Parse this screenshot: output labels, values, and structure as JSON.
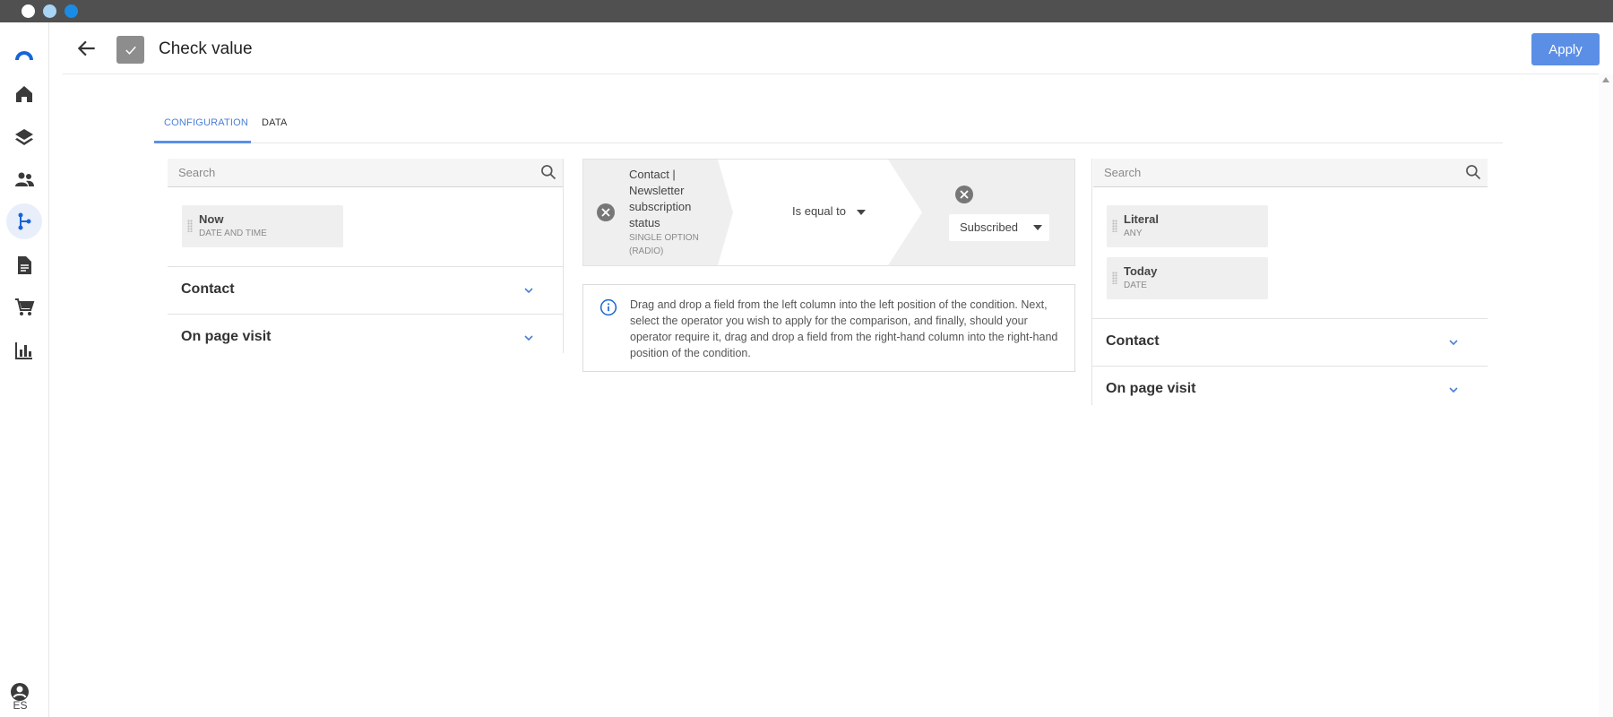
{
  "window": {
    "dots": [
      "#ffffff",
      "#a8d4f5",
      "#1a8ce8"
    ]
  },
  "sidebar": {
    "items": [
      {
        "icon": "logo-icon"
      },
      {
        "icon": "home-icon"
      },
      {
        "icon": "layers-icon"
      },
      {
        "icon": "people-icon"
      },
      {
        "icon": "flow-icon",
        "active": true
      },
      {
        "icon": "document-icon"
      },
      {
        "icon": "cart-icon"
      },
      {
        "icon": "chart-icon"
      }
    ],
    "user_icon": "account-icon",
    "language": "ES"
  },
  "header": {
    "title": "Check value",
    "apply_label": "Apply"
  },
  "tabs": [
    {
      "label": "CONFIGURATION",
      "active": true
    },
    {
      "label": "DATA",
      "active": false
    }
  ],
  "left_panel": {
    "search_placeholder": "Search",
    "chips": [
      {
        "name": "Now",
        "type": "DATE AND TIME"
      }
    ],
    "groups": [
      {
        "label": "Contact"
      },
      {
        "label": "On page visit"
      }
    ]
  },
  "condition": {
    "field_name": "Contact | Newsletter subscription status",
    "field_type": "SINGLE OPTION (RADIO)",
    "operator": "Is equal to",
    "value": "Subscribed"
  },
  "info": {
    "text": "Drag and drop a field from the left column into the left position of the condition. Next, select the operator you wish to apply for the comparison, and finally, should your operator require it, drag and drop a field from the right-hand column into the right-hand position of the condition."
  },
  "right_panel": {
    "search_placeholder": "Search",
    "chips": [
      {
        "name": "Literal",
        "type": "ANY"
      },
      {
        "name": "Today",
        "type": "DATE"
      }
    ],
    "groups": [
      {
        "label": "Contact"
      },
      {
        "label": "On page visit"
      }
    ]
  },
  "colors": {
    "accent": "#5b8fe6",
    "brand": "#1565d8"
  }
}
